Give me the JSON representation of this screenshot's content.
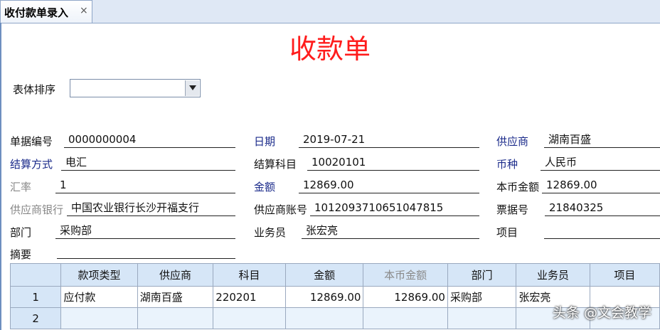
{
  "tab": {
    "title": "收付款单录入",
    "close": "×"
  },
  "title": "收款单",
  "sort": {
    "label": "表体排序",
    "value": ""
  },
  "fields": {
    "doc_no": {
      "label": "单据编号",
      "value": "0000000004"
    },
    "date": {
      "label": "日期",
      "value": "2019-07-21"
    },
    "supplier": {
      "label": "供应商",
      "value": "湖南百盛"
    },
    "settle_method": {
      "label": "结算方式",
      "value": "电汇"
    },
    "settle_subject": {
      "label": "结算科目",
      "value": "10020101"
    },
    "currency": {
      "label": "币种",
      "value": "人民币"
    },
    "rate": {
      "label": "汇率",
      "value": "1"
    },
    "amount": {
      "label": "金额",
      "value": "12869.00"
    },
    "local_amount": {
      "label": "本币金额",
      "value": "12869.00"
    },
    "supplier_bank": {
      "label": "供应商银行",
      "value": "中国农业银行长沙开福支行"
    },
    "supplier_account": {
      "label": "供应商账号",
      "value": "1012093710651047815"
    },
    "bill_no": {
      "label": "票据号",
      "value": "21840325"
    },
    "department": {
      "label": "部门",
      "value": "采购部"
    },
    "salesman": {
      "label": "业务员",
      "value": "张宏亮"
    },
    "project": {
      "label": "项目",
      "value": ""
    },
    "summary": {
      "label": "摘要",
      "value": ""
    }
  },
  "table": {
    "headers": [
      "",
      "款项类型",
      "供应商",
      "科目",
      "金额",
      "本币金额",
      "部门",
      "业务员",
      "项目"
    ],
    "rows": [
      [
        "1",
        "应付款",
        "湖南百盛",
        "220201",
        "12869.00",
        "12869.00",
        "采购部",
        "张宏亮",
        ""
      ],
      [
        "2",
        "",
        "",
        "",
        "",
        "",
        "",
        "",
        ""
      ]
    ]
  },
  "watermark": "头条 @文会教学",
  "colors": {
    "title": "#ff1c1c",
    "link_label": "#1a2a8a",
    "disabled_label": "#888888",
    "grid_header": "#d6e6f7"
  }
}
